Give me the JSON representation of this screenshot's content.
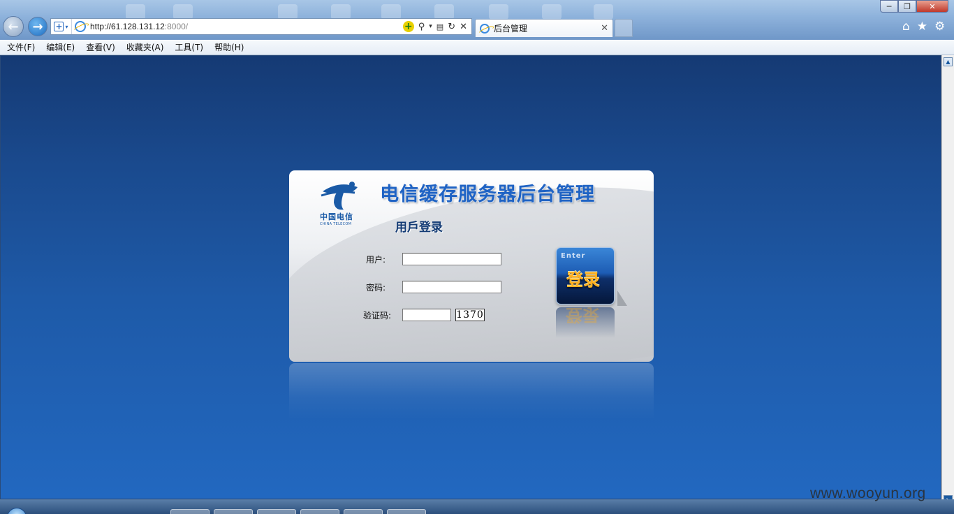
{
  "browser": {
    "url_host": "http://61.128.131.12",
    "url_port": ":8000/",
    "tab_title": "后台管理",
    "menu": [
      "文件(F)",
      "编辑(E)",
      "查看(V)",
      "收藏夹(A)",
      "工具(T)",
      "帮助(H)"
    ]
  },
  "login": {
    "logo_text": "中国电信",
    "logo_sub": "CHINA TELECOM",
    "title": "电信缓存服务器后台管理",
    "subtitle": "用戶登录",
    "user_label": "用户:",
    "user_value": "",
    "password_label": "密码:",
    "password_value": "",
    "captcha_label": "验证码:",
    "captcha_value": "",
    "captcha_code": "1370",
    "enter_en": "Enter",
    "enter_cn": "登录"
  },
  "watermark": "www.wooyun.org",
  "colors": {
    "accent": "#1f63c4",
    "page_bg": "#1e5aa8"
  }
}
